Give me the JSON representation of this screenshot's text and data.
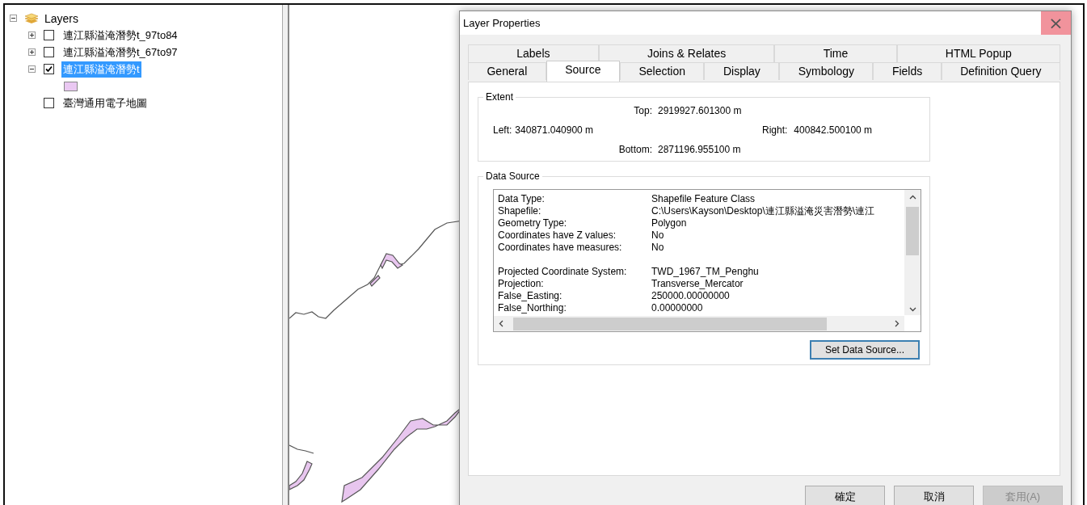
{
  "toc": {
    "root": {
      "label": "Layers",
      "expanded": true,
      "layers": [
        {
          "label": "連江縣溢淹潛勢t_97to84",
          "checked": false,
          "expanded": false,
          "selected": false
        },
        {
          "label": "連江縣溢淹潛勢t_67to97",
          "checked": false,
          "expanded": false,
          "selected": false
        },
        {
          "label": "連江縣溢淹潛勢t",
          "checked": true,
          "expanded": true,
          "selected": true
        },
        {
          "label": "臺灣通用電子地圖",
          "checked": false,
          "selected": false
        }
      ]
    }
  },
  "dialog": {
    "title": "Layer Properties",
    "close": {
      "label": "×",
      "hovered": true
    },
    "tab_rows": [
      [
        {
          "label": "Labels",
          "selected": false
        },
        {
          "label": "Joins & Relates",
          "selected": false
        },
        {
          "label": "Time",
          "selected": false
        },
        {
          "label": "HTML Popup",
          "selected": false
        }
      ],
      [
        {
          "label": "General",
          "selected": false
        },
        {
          "label": "Source",
          "selected": true
        },
        {
          "label": "Selection",
          "selected": false
        },
        {
          "label": "Display",
          "selected": false
        },
        {
          "label": "Symbology",
          "selected": false
        },
        {
          "label": "Fields",
          "selected": false
        },
        {
          "label": "Definition Query",
          "selected": false
        }
      ]
    ],
    "extent": {
      "title": "Extent",
      "top": {
        "label": "Top:",
        "value": "2919927.601300 m"
      },
      "left": {
        "label": "Left:",
        "value": "340871.040900 m"
      },
      "right": {
        "label": "Right:",
        "value": "400842.500100 m"
      },
      "bottom": {
        "label": "Bottom:",
        "value": "2871196.955100 m"
      }
    },
    "data_source": {
      "title": "Data Source",
      "sections": [
        [
          {
            "label": "Data Type:",
            "value": "Shapefile Feature Class"
          },
          {
            "label": "Shapefile:",
            "value": "C:\\Users\\Kayson\\Desktop\\連江縣溢淹災害潛勢\\連江"
          },
          {
            "label": "Geometry Type:",
            "value": "Polygon"
          },
          {
            "label": "Coordinates have Z values:",
            "value": "No"
          },
          {
            "label": "Coordinates have measures:",
            "value": "No"
          }
        ],
        [
          {
            "label": "Projected Coordinate System:",
            "value": "TWD_1967_TM_Penghu"
          },
          {
            "label": "Projection:",
            "value": "Transverse_Mercator"
          },
          {
            "label": "False_Easting:",
            "value": "250000.00000000"
          },
          {
            "label": "False_Northing:",
            "value": "0.00000000"
          }
        ]
      ],
      "button": {
        "label": "Set Data Source...",
        "focused": true
      }
    },
    "buttons": [
      {
        "label": "確定",
        "disabled": false
      },
      {
        "label": "取消",
        "disabled": false
      },
      {
        "label": "套用(A)",
        "disabled": true
      }
    ]
  }
}
